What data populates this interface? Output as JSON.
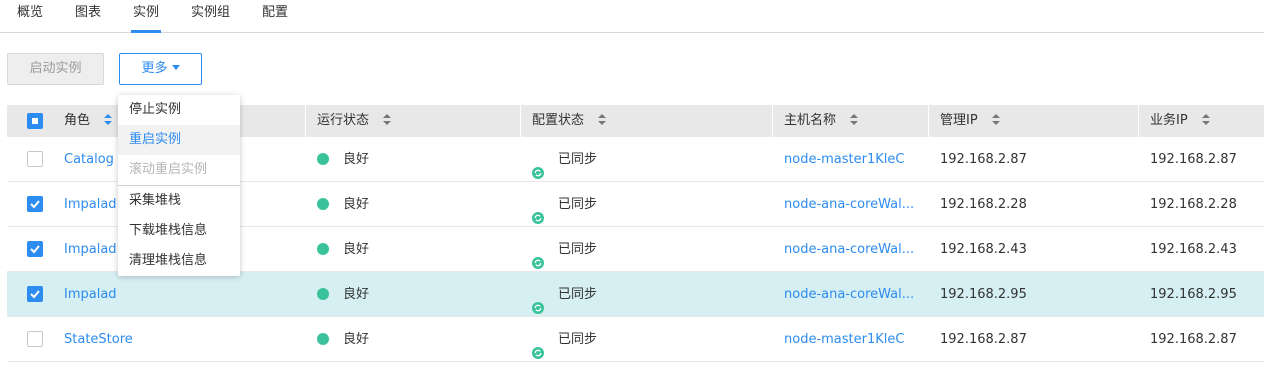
{
  "tabs": [
    {
      "label": "概览"
    },
    {
      "label": "图表"
    },
    {
      "label": "实例",
      "active": true
    },
    {
      "label": "实例组"
    },
    {
      "label": "配置"
    }
  ],
  "toolbar": {
    "start_label": "启动实例",
    "more_label": "更多"
  },
  "dropdown": {
    "items": [
      {
        "label": "停止实例"
      },
      {
        "label": "重启实例",
        "state": "hover"
      },
      {
        "label": "滚动重启实例",
        "state": "disabled"
      },
      {
        "label": "采集堆栈"
      },
      {
        "label": "下载堆栈信息"
      },
      {
        "label": "清理堆栈信息"
      }
    ]
  },
  "table": {
    "header_checkbox": "partial",
    "columns": [
      {
        "label": "角色"
      },
      {
        "label": "运行状态"
      },
      {
        "label": "配置状态"
      },
      {
        "label": "主机名称"
      },
      {
        "label": "管理IP"
      },
      {
        "label": "业务IP"
      }
    ],
    "rows": [
      {
        "checked": false,
        "role": "Catalog",
        "run_status": "良好",
        "config_status": "已同步",
        "host": "node-master1KleC",
        "mgmt_ip": "192.168.2.87",
        "biz_ip": "192.168.2.87"
      },
      {
        "checked": true,
        "role": "Impalad",
        "run_status": "良好",
        "config_status": "已同步",
        "host": "node-ana-coreWal...",
        "mgmt_ip": "192.168.2.28",
        "biz_ip": "192.168.2.28"
      },
      {
        "checked": true,
        "role": "Impalad",
        "run_status": "良好",
        "config_status": "已同步",
        "host": "node-ana-coreWal...",
        "mgmt_ip": "192.168.2.43",
        "biz_ip": "192.168.2.43"
      },
      {
        "checked": true,
        "role": "Impalad",
        "run_status": "良好",
        "config_status": "已同步",
        "host": "node-ana-coreWal...",
        "mgmt_ip": "192.168.2.95",
        "biz_ip": "192.168.2.95",
        "highlighted": true
      },
      {
        "checked": false,
        "role": "StateStore",
        "run_status": "良好",
        "config_status": "已同步",
        "host": "node-master1KleC",
        "mgmt_ip": "192.168.2.87",
        "biz_ip": "192.168.2.87"
      }
    ]
  },
  "colors": {
    "accent": "#2d8cf0",
    "status_good": "#3ac29a",
    "row_highlight": "#d5eff2",
    "header_bg": "#e8e8e8"
  },
  "icons": {
    "run_status": "green-dot-icon",
    "config_status": "sync-icon",
    "sort": "sort-arrows-icon"
  }
}
